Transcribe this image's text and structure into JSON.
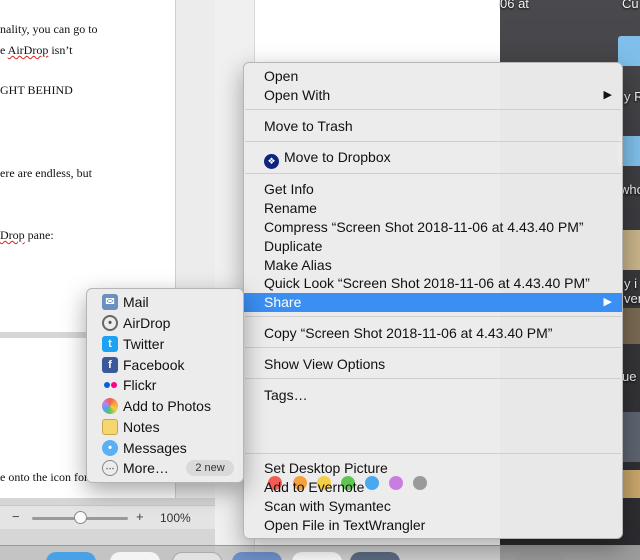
{
  "document": {
    "lines": [
      "nality, you can go to",
      "e AirDrop isn’t",
      "GHT BEHIND",
      "ere are endless, but",
      "Drop pane:",
      "e onto the icon for"
    ],
    "zoom_minus": "−",
    "zoom_plus": "+",
    "zoom_level": "100%"
  },
  "desktop": {
    "labels": [
      "06 at",
      "Cu",
      "y R",
      "who",
      "y i",
      "ver",
      "ue"
    ]
  },
  "context_menu": {
    "open": "Open",
    "open_with": "Open With",
    "move_to_trash": "Move to Trash",
    "move_to_dropbox": "Move to Dropbox",
    "get_info": "Get Info",
    "rename": "Rename",
    "compress": "Compress “Screen Shot 2018-11-06 at 4.43.40 PM”",
    "duplicate": "Duplicate",
    "make_alias": "Make Alias",
    "quick_look": "Quick Look “Screen Shot 2018-11-06 at 4.43.40 PM”",
    "share": "Share",
    "copy": "Copy “Screen Shot 2018-11-06 at 4.43.40 PM”",
    "show_view_options": "Show View Options",
    "tags": "Tags…",
    "set_desktop_picture": "Set Desktop Picture",
    "add_to_evernote": "Add to Evernote",
    "scan_with_symantec": "Scan with Symantec",
    "open_in_textwrangler": "Open File in TextWrangler",
    "submenu_arrow": "▶",
    "tag_colors": [
      "#f25c54",
      "#f6a03d",
      "#f5cd47",
      "#5fc751",
      "#4aa8f0",
      "#c77ee0",
      "#9a9a9a"
    ]
  },
  "share_menu": {
    "mail": "Mail",
    "airdrop": "AirDrop",
    "twitter": "Twitter",
    "facebook": "Facebook",
    "flickr": "Flickr",
    "add_to_photos": "Add to Photos",
    "notes": "Notes",
    "messages": "Messages",
    "more": "More…",
    "new_badge": "2 new"
  }
}
